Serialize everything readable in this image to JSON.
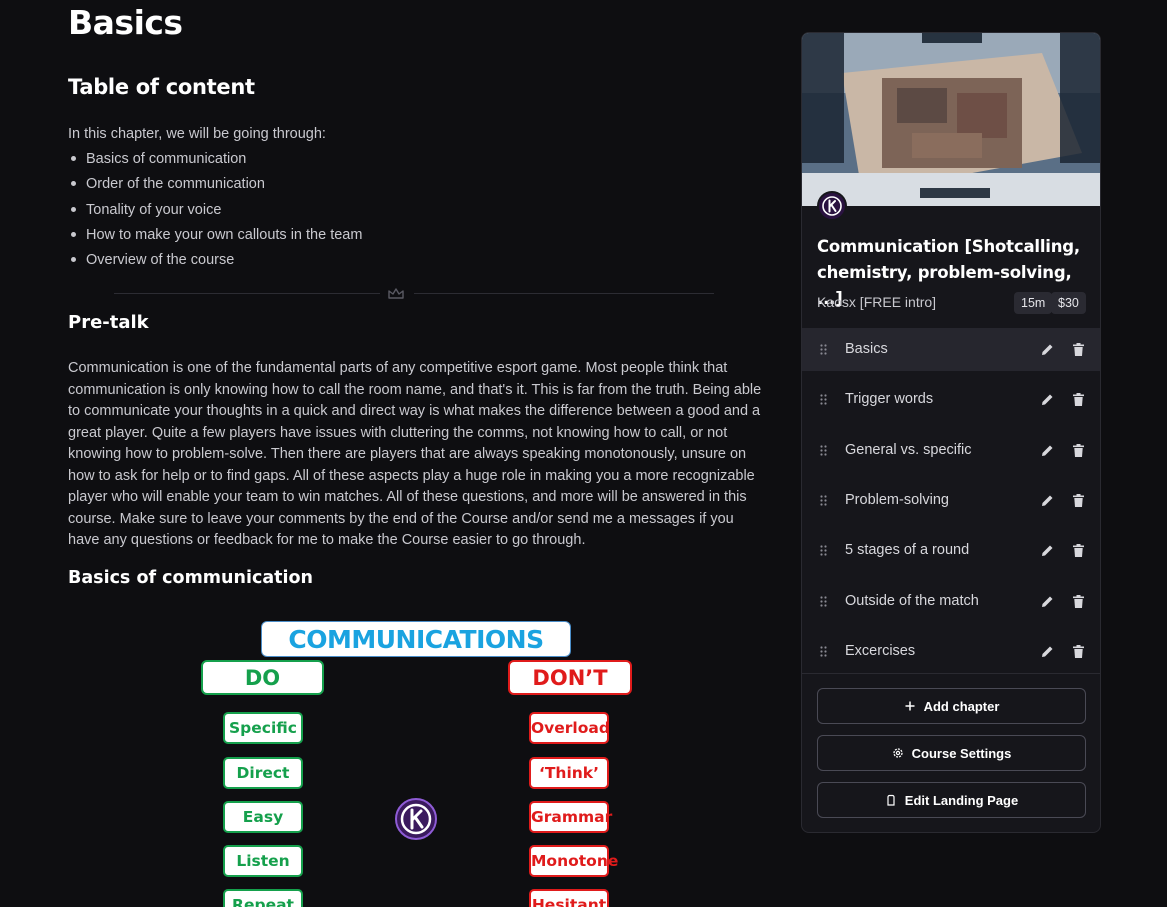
{
  "page": {
    "title": "Basics",
    "toc_title": "Table of content",
    "intro": "In this chapter, we will be going through:",
    "toc_items": [
      "Basics of communication",
      "Order of the communication",
      "Tonality of your voice",
      "How to make your own callouts in the team",
      "Overview of the course"
    ],
    "pretalk_title": "Pre-talk",
    "pretalk_body": "Communication is one of the fundamental parts of any competitive esport game. Most people think that communication is only knowing how to call the room name, and that's it. This is far from the truth. Being able to communicate your thoughts in a quick and direct way is what makes the difference between a good and a great player. Quite a few players have issues with cluttering the comms, not knowing how to call, or not knowing how to problem-solve. Then there are players that are always speaking monotonously, unsure on how to ask for help or to find gaps. All of these aspects play a huge role in making you a more recognizable player who will enable your team to win matches. All of these questions, and more will be answered in this course. Make sure to leave your comments by the end of the Course and/or send me a messages if you have any questions or feedback for me to make the Course easier to go through.",
    "basics_title": "Basics of communication"
  },
  "graphic": {
    "title": "COMMUNICATIONS",
    "do_label": "DO",
    "dont_label": "DON’T",
    "do_items": [
      "Specific",
      "Direct",
      "Easy",
      "Listen",
      "Repeat"
    ],
    "dont_items": [
      "Overload",
      "‘Think’",
      "Grammar",
      "Monotone",
      "Hesitant"
    ],
    "colors": {
      "do": "#15a04c",
      "dont": "#e01b1b",
      "title": "#1aa3e0"
    }
  },
  "course": {
    "title": "Communication [Shotcalling, chemistry, problem-solving, ...]",
    "author": "Kaosx [FREE intro]",
    "duration": "15m",
    "price": "$30",
    "chapters": [
      {
        "label": "Basics",
        "active": true
      },
      {
        "label": "Trigger words",
        "active": false
      },
      {
        "label": "General vs. specific",
        "active": false
      },
      {
        "label": "Problem-solving",
        "active": false
      },
      {
        "label": "5 stages of a round",
        "active": false
      },
      {
        "label": "Outside of the match",
        "active": false
      },
      {
        "label": "Excercises",
        "active": false
      }
    ],
    "buttons": {
      "add_chapter": "Add chapter",
      "course_settings": "Course Settings",
      "edit_landing": "Edit Landing Page"
    }
  }
}
